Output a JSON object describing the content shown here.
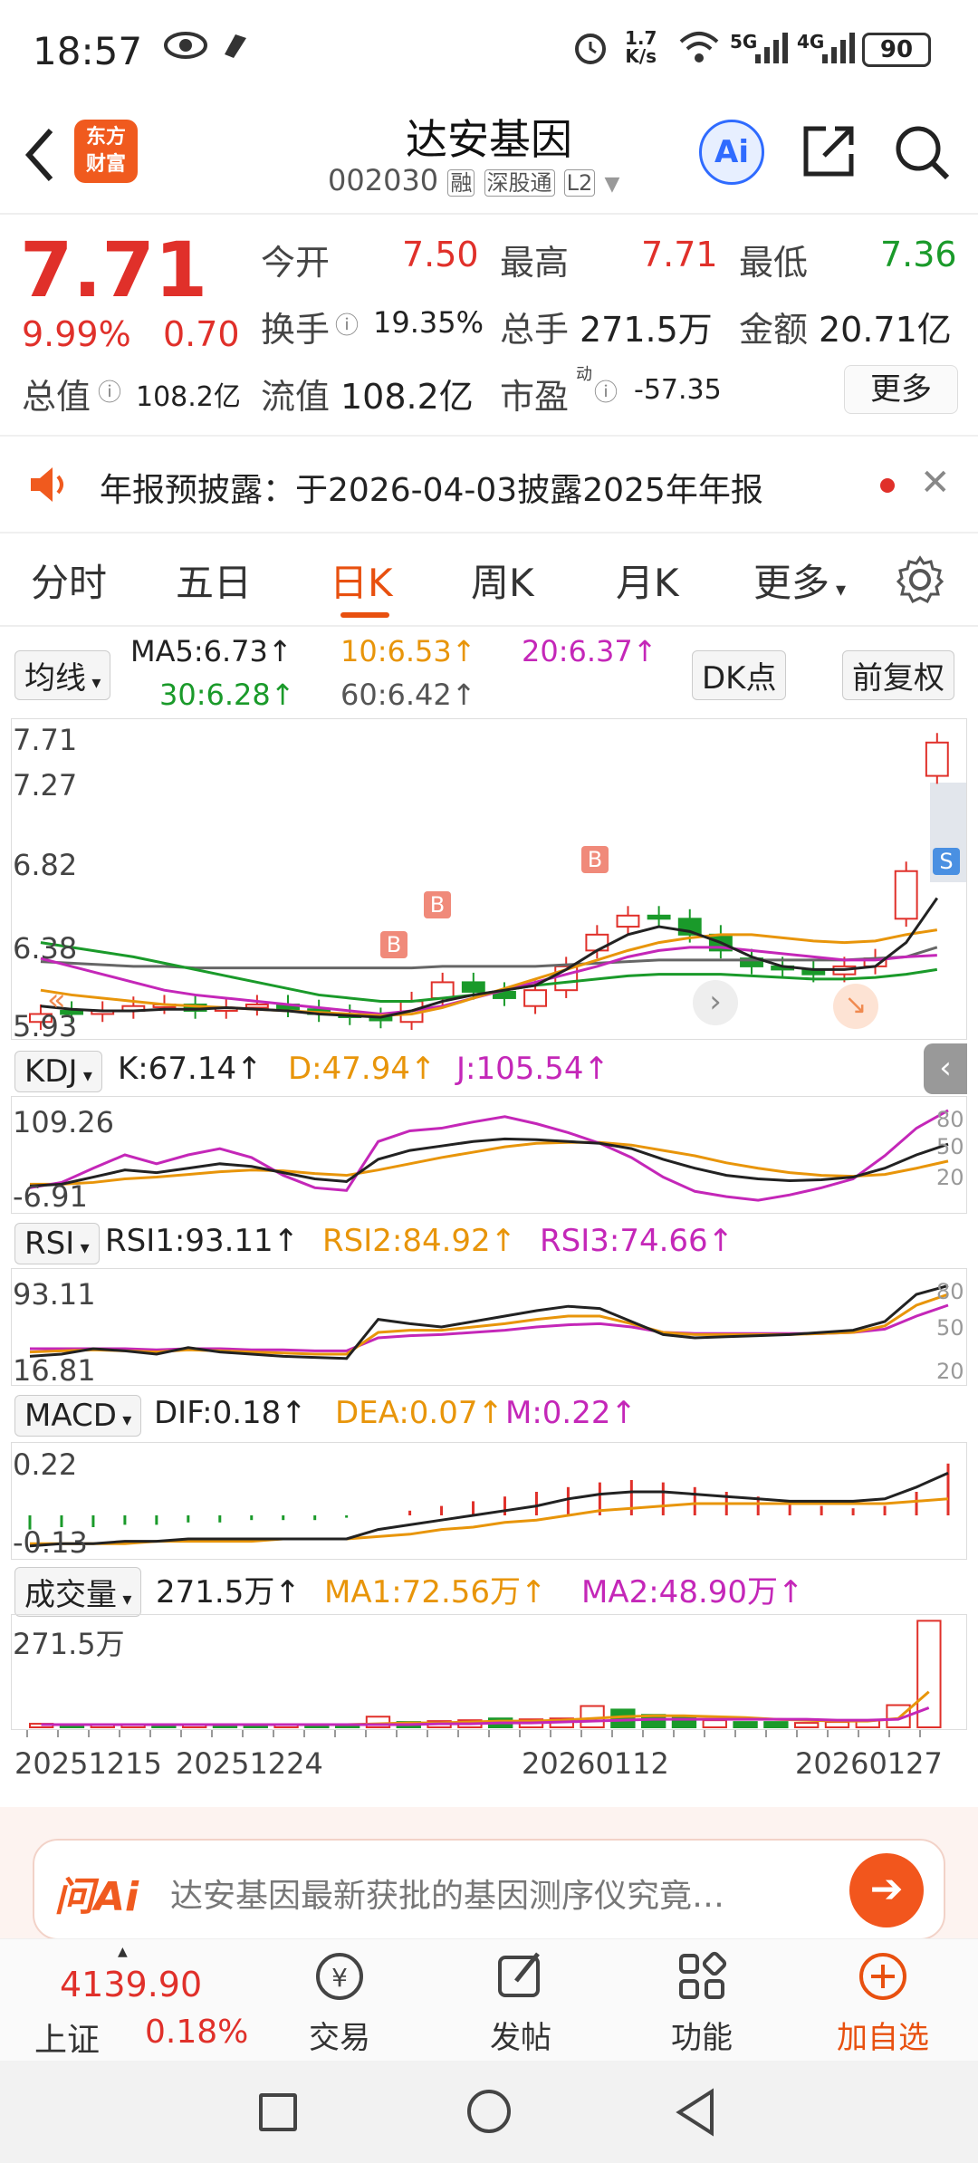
{
  "status": {
    "time": "18:57",
    "speed_top": "1.7",
    "speed_bottom": "K/s",
    "sig1": "5G",
    "sig2": "4G",
    "battery": "90"
  },
  "header": {
    "logo_line1": "东方",
    "logo_line2": "财富",
    "title": "达安基因",
    "code": "002030",
    "tag_rong": "融",
    "tag_sgt": "深股通",
    "tag_l2": "L2",
    "ai_label": "Ai"
  },
  "quote": {
    "price": "7.71",
    "change_pct": "9.99%",
    "change": "0.70",
    "open_label": "今开",
    "open": "7.50",
    "high_label": "最高",
    "high": "7.71",
    "low_label": "最低",
    "low": "7.36",
    "turnover_label": "换手",
    "turnover": "19.35%",
    "volume_label": "总手",
    "volume": "271.5万",
    "amount_label": "金额",
    "amount": "20.71亿",
    "mktcap_label": "总值",
    "mktcap": "108.2亿",
    "float_label": "流值",
    "float": "108.2亿",
    "pe_label": "市盈",
    "pe_sup": "动",
    "pe": "-57.35",
    "more": "更多"
  },
  "notice": {
    "text": "年报预披露：于2026-04-03披露2025年年报"
  },
  "tabs": [
    "分时",
    "五日",
    "日K",
    "周K",
    "月K",
    "更多"
  ],
  "ma": {
    "selector": "均线",
    "ma5": "MA5:6.73↑",
    "ma10": "10:6.53↑",
    "ma20": "20:6.37↑",
    "ma30": "30:6.28↑",
    "ma60": "60:6.42↑",
    "dk": "DK点",
    "fq": "前复权"
  },
  "kline": {
    "y_labels": [
      "7.71",
      "7.27",
      "6.82",
      "6.38",
      "5.93"
    ],
    "b_marker": "B",
    "s_marker": "S"
  },
  "kdj": {
    "selector": "KDJ",
    "k": "K:67.14↑",
    "d": "D:47.94↑",
    "j": "J:105.54↑",
    "top": "109.26",
    "bottom": "-6.91",
    "r80": "80",
    "r50": "50",
    "r20": "20"
  },
  "rsi": {
    "selector": "RSI",
    "rsi1": "RSI1:93.11↑",
    "rsi2": "RSI2:84.92↑",
    "rsi3": "RSI3:74.66↑",
    "top": "93.11",
    "bottom": "16.81",
    "r80": "80",
    "r50": "50",
    "r20": "20"
  },
  "macd": {
    "selector": "MACD",
    "dif": "DIF:0.18↑",
    "dea": "DEA:0.07↑",
    "m": "M:0.22↑",
    "top": "0.22",
    "bottom": "-0.13"
  },
  "vol": {
    "selector": "成交量",
    "val": "271.5万↑",
    "ma1": "MA1:72.56万↑",
    "ma2": "MA2:48.90万↑",
    "top": "271.5万"
  },
  "dates": [
    "20251215",
    "20251224",
    "20260112",
    "20260127"
  ],
  "ai": {
    "logo": "问Ai",
    "text": "达安基因最新获批的基因测序仪究竟…"
  },
  "nav": {
    "index_value": "4139.90",
    "index_name": "上证",
    "index_pct": "0.18%",
    "trade": "交易",
    "post": "发帖",
    "func": "功能",
    "add": "加自选"
  }
}
